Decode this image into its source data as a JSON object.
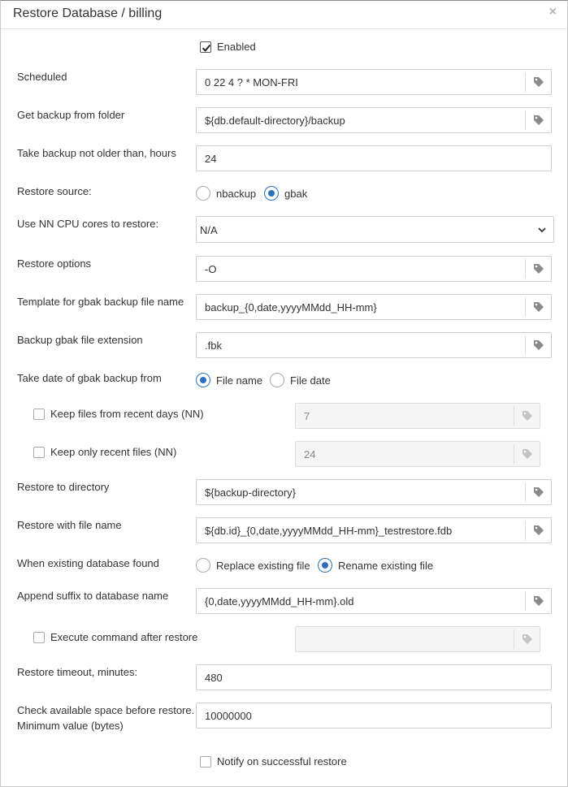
{
  "dialog": {
    "title": "Restore Database / billing",
    "close": "×"
  },
  "enabled": {
    "label": "Enabled",
    "checked": true
  },
  "scheduled": {
    "label": "Scheduled",
    "value": "0 22 4 ? * MON-FRI"
  },
  "backup_folder": {
    "label": "Get backup from folder",
    "value": "${db.default-directory}/backup"
  },
  "not_older": {
    "label": "Take backup not older than, hours",
    "value": "24"
  },
  "restore_source": {
    "label": "Restore source:",
    "options": [
      "nbackup",
      "gbak"
    ],
    "selected": "gbak"
  },
  "cpu_cores": {
    "label": "Use NN CPU cores to restore:",
    "value": "N/A"
  },
  "restore_options": {
    "label": "Restore options",
    "value": "-O"
  },
  "template": {
    "label": "Template for gbak backup file name",
    "value": "backup_{0,date,yyyyMMdd_HH-mm}"
  },
  "extension": {
    "label": "Backup gbak file extension",
    "value": ".fbk"
  },
  "date_from": {
    "label": "Take date of gbak backup from",
    "options": [
      "File name",
      "File date"
    ],
    "selected": "File name"
  },
  "keep_days": {
    "label": "Keep files from recent days (NN)",
    "value": "7",
    "checked": false
  },
  "keep_recent": {
    "label": "Keep only recent files (NN)",
    "value": "24",
    "checked": false
  },
  "restore_dir": {
    "label": "Restore to directory",
    "value": "${backup-directory}"
  },
  "restore_name": {
    "label": "Restore with file name",
    "value": "${db.id}_{0,date,yyyyMMdd_HH-mm}_testrestore.fdb"
  },
  "existing_db": {
    "label": "When existing database found",
    "options": [
      "Replace existing file",
      "Rename existing file"
    ],
    "selected": "Rename existing file"
  },
  "suffix": {
    "label": "Append suffix to database name",
    "value": "{0,date,yyyyMMdd_HH-mm}.old"
  },
  "exec_cmd": {
    "label": "Execute command after restore",
    "value": "",
    "checked": false
  },
  "timeout": {
    "label": "Restore timeout, minutes:",
    "value": "480"
  },
  "space": {
    "label_line1": "Check available space before restore.",
    "label_line2": "Minimum value (bytes)",
    "value": "10000000"
  },
  "notify": {
    "label": "Notify on successful restore",
    "checked": false
  }
}
